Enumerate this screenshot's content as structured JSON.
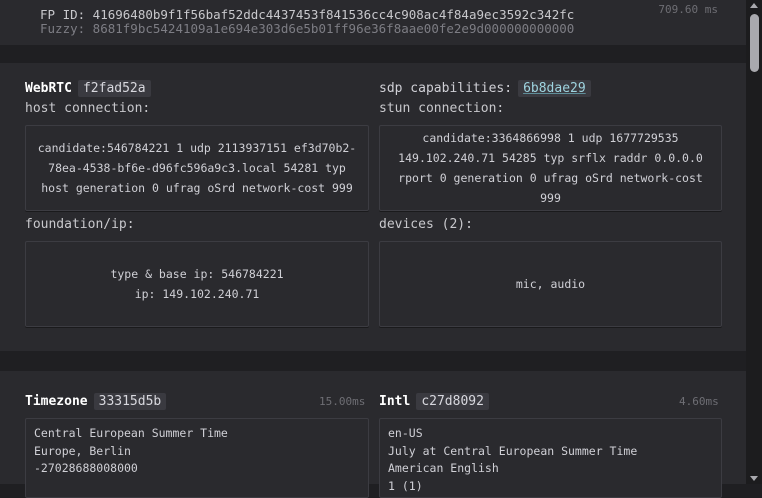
{
  "header": {
    "fp_id_line": "FP ID: 41696480b9f1f56baf52ddc4437453f841536cc4c908ac4f84a9ec3592c342fc",
    "fuzzy_line": "Fuzzy: 8681f9bc5424109a1e694e303d6e5b01ff96e36f8aae00fe2e9d000000000000",
    "timing": "709.60 ms"
  },
  "webrtc": {
    "title": "WebRTC",
    "hash": "f2fad52a",
    "host_label": "host connection:",
    "host_value": "candidate:546784221 1 udp 2113937151 ef3d70b2-78ea-4538-bf6e-d96fc596a9c3.local 54281 typ host generation 0 ufrag oSrd network-cost 999",
    "foundation_label": "foundation/ip:",
    "foundation_lines": [
      "type & base ip: 546784221",
      "ip: 149.102.240.71"
    ],
    "sdp_label": "sdp capabilities:",
    "sdp_hash": "6b8dae29",
    "stun_label": "stun connection:",
    "stun_value": "candidate:3364866998 1 udp 1677729535 149.102.240.71 54285 typ srflx raddr 0.0.0.0 rport 0 generation 0 ufrag oSrd network-cost 999",
    "devices_label": "devices (2):",
    "devices_value": "mic, audio"
  },
  "timezone": {
    "title": "Timezone",
    "hash": "33315d5b",
    "timing": "15.00ms",
    "lines": [
      "Central European Summer Time",
      "Europe, Berlin",
      "-27028688008000"
    ]
  },
  "intl": {
    "title": "Intl",
    "hash": "c27d8092",
    "timing": "4.60ms",
    "lines": [
      "en-US",
      "July at Central European Summer Time",
      "American English",
      "1 (1)"
    ]
  }
}
